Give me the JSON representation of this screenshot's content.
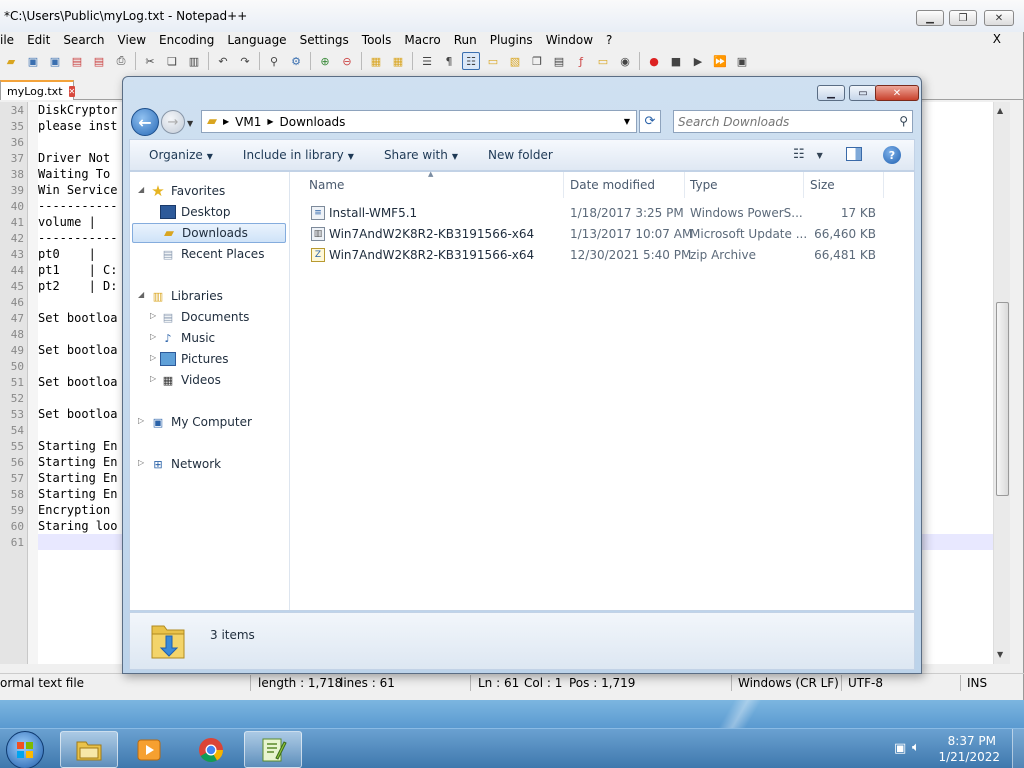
{
  "npp": {
    "title": "*C:\\Users\\Public\\myLog.txt - Notepad++",
    "menu": [
      "ile",
      "Edit",
      "Search",
      "View",
      "Encoding",
      "Language",
      "Settings",
      "Tools",
      "Macro",
      "Run",
      "Plugins",
      "Window",
      "?"
    ],
    "menu_close": "X",
    "tab_label": "myLog.txt",
    "lines": [
      {
        "n": "34",
        "t": "DiskCryptor"
      },
      {
        "n": "35",
        "t": "please inst"
      },
      {
        "n": "36",
        "t": ""
      },
      {
        "n": "37",
        "t": "Driver Not"
      },
      {
        "n": "38",
        "t": "Waiting To"
      },
      {
        "n": "39",
        "t": "Win Service"
      },
      {
        "n": "40",
        "t": "-----------"
      },
      {
        "n": "41",
        "t": "volume |"
      },
      {
        "n": "42",
        "t": "-----------"
      },
      {
        "n": "43",
        "t": "pt0    |"
      },
      {
        "n": "44",
        "t": "pt1    | C:"
      },
      {
        "n": "45",
        "t": "pt2    | D:"
      },
      {
        "n": "46",
        "t": ""
      },
      {
        "n": "47",
        "t": "Set bootloa"
      },
      {
        "n": "48",
        "t": ""
      },
      {
        "n": "49",
        "t": "Set bootloa"
      },
      {
        "n": "50",
        "t": ""
      },
      {
        "n": "51",
        "t": "Set bootloa"
      },
      {
        "n": "52",
        "t": ""
      },
      {
        "n": "53",
        "t": "Set bootloa"
      },
      {
        "n": "54",
        "t": ""
      },
      {
        "n": "55",
        "t": "Starting En"
      },
      {
        "n": "56",
        "t": "Starting En"
      },
      {
        "n": "57",
        "t": "Starting En"
      },
      {
        "n": "58",
        "t": "Starting En"
      },
      {
        "n": "59",
        "t": "Encryption"
      },
      {
        "n": "60",
        "t": "Staring loo"
      },
      {
        "n": "61",
        "t": ""
      }
    ],
    "status": {
      "type": "ormal text file",
      "length": "length : 1,718",
      "lines": "lines : 61",
      "ln": "Ln : 61",
      "col": "Col : 1",
      "pos": "Pos : 1,719",
      "eol": "Windows (CR LF)",
      "encoding": "UTF-8",
      "mode": "INS"
    }
  },
  "explorer": {
    "breadcrumb": [
      "VM1",
      "Downloads"
    ],
    "search_placeholder": "Search Downloads",
    "commands": [
      "Organize",
      "Include in library",
      "Share with",
      "New folder"
    ],
    "help": "?",
    "nav": {
      "favorites": "Favorites",
      "desktop": "Desktop",
      "downloads": "Downloads",
      "recent": "Recent Places",
      "libraries": "Libraries",
      "documents": "Documents",
      "music": "Music",
      "pictures": "Pictures",
      "videos": "Videos",
      "computer": "My Computer",
      "network": "Network"
    },
    "columns": {
      "name": "Name",
      "date": "Date modified",
      "type": "Type",
      "size": "Size"
    },
    "files": [
      {
        "name": "Install-WMF5.1",
        "date": "1/18/2017 3:25 PM",
        "type": "Windows PowerS...",
        "size": "17 KB",
        "icon": "powershell-script-icon"
      },
      {
        "name": "Win7AndW2K8R2-KB3191566-x64",
        "date": "1/13/2017 10:07 AM",
        "type": "Microsoft Update ...",
        "size": "66,460 KB",
        "icon": "update-package-icon"
      },
      {
        "name": "Win7AndW2K8R2-KB3191566-x64",
        "date": "12/30/2021 5:40 PM",
        "type": "zip Archive",
        "size": "66,481 KB",
        "icon": "zip-archive-icon"
      }
    ],
    "item_count": "3 items"
  },
  "taskbar": {
    "time": "8:37 PM",
    "date": "1/21/2022",
    "apps": [
      "explorer-icon",
      "media-player-icon",
      "chrome-icon",
      "notepadpp-icon"
    ]
  },
  "colors": {
    "accent": "#3f78ad",
    "tab_marker": "#f3a33a",
    "close_red": "#c8412c"
  }
}
